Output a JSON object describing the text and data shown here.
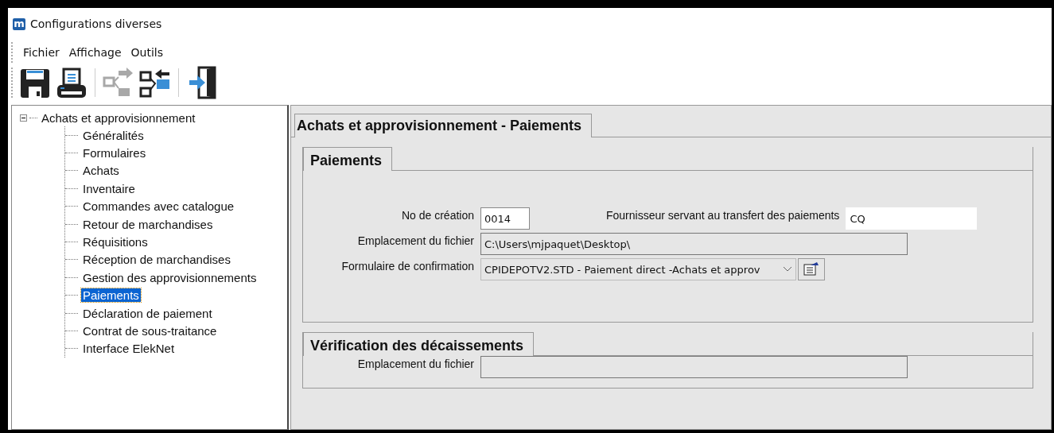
{
  "window": {
    "app_mark": "m",
    "title": "Configurations diverses"
  },
  "menu": [
    "Fichier",
    "Affichage",
    "Outils"
  ],
  "toolbar": [
    {
      "kind": "save",
      "disabled": false
    },
    {
      "kind": "print",
      "disabled": false
    },
    {
      "kind": "send",
      "disabled": true
    },
    {
      "kind": "receive",
      "disabled": false
    },
    {
      "kind": "exit",
      "disabled": false
    }
  ],
  "tree": {
    "label": "Achats et approvisionnement",
    "expanded": true,
    "children": [
      {
        "label": "Généralités",
        "selected": false
      },
      {
        "label": "Formulaires",
        "selected": false
      },
      {
        "label": "Achats",
        "selected": false
      },
      {
        "label": "Inventaire",
        "selected": false
      },
      {
        "label": "Commandes avec catalogue",
        "selected": false
      },
      {
        "label": "Retour de marchandises",
        "selected": false
      },
      {
        "label": "Réquisitions",
        "selected": false
      },
      {
        "label": "Réception de marchandises",
        "selected": false
      },
      {
        "label": "Gestion des approvisionnements",
        "selected": false
      },
      {
        "label": "Paiements",
        "selected": true
      },
      {
        "label": "Déclaration de paiement",
        "selected": false
      },
      {
        "label": "Contrat de sous-traitance",
        "selected": false
      },
      {
        "label": "Interface ElekNet",
        "selected": false
      }
    ]
  },
  "tab": {
    "title": "Achats et approvisionnement - Paiements"
  },
  "groups": [
    {
      "title": "Paiements",
      "rows": [
        [
          {
            "label": "No de création",
            "kind": "text",
            "value": "0014"
          },
          {
            "label": "Fournisseur servant au transfert des paiements",
            "kind": "text",
            "value": "CQ"
          }
        ],
        [
          {
            "label": "Emplacement du fichier",
            "kind": "readonly",
            "value": "C:\\Users\\mjpaquet\\Desktop\\"
          }
        ],
        [
          {
            "label": "Formulaire de confirmation",
            "kind": "select",
            "value": "CPIDEPOTV2.STD - Paiement direct -Achats et approv"
          }
        ]
      ]
    },
    {
      "title": "Vérification des décaissements",
      "rows": [
        [
          {
            "label": "Emplacement du fichier",
            "kind": "readonly"
          }
        ]
      ]
    }
  ]
}
